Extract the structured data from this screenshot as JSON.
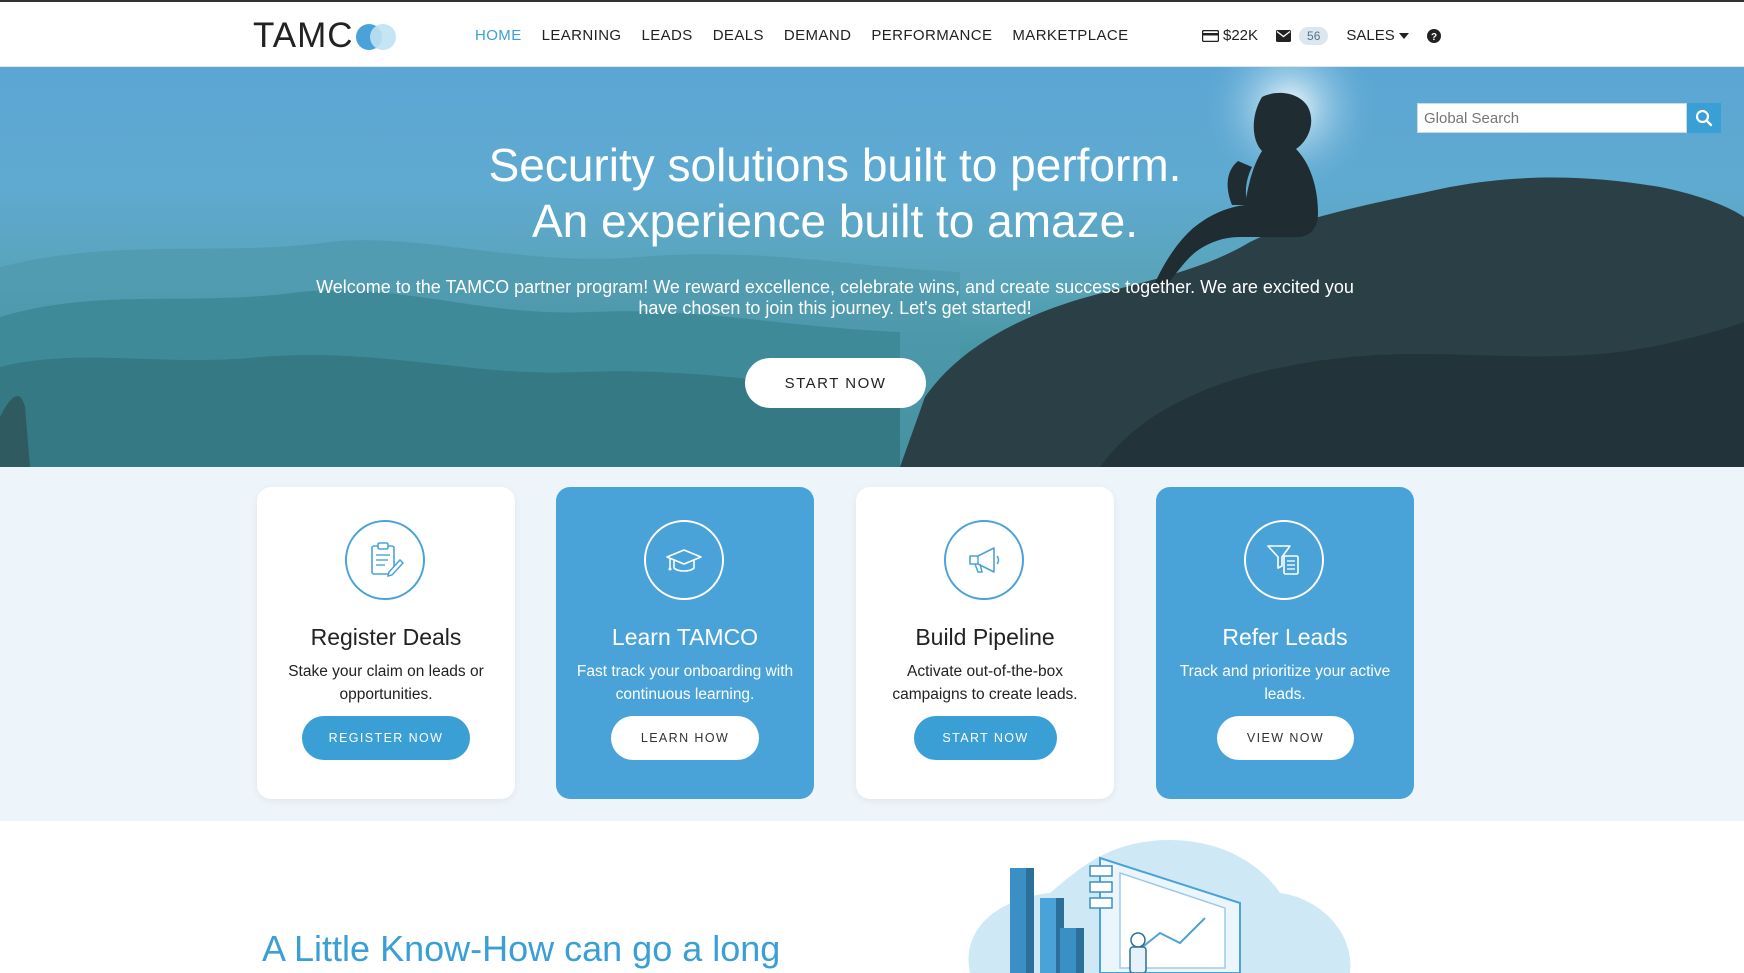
{
  "brand": {
    "logo_text": "TAMC",
    "accent": "#3a9fd5"
  },
  "nav": {
    "items": [
      "HOME",
      "LEARNING",
      "LEADS",
      "DEALS",
      "DEMAND",
      "PERFORMANCE",
      "MARKETPLACE"
    ],
    "active": "HOME"
  },
  "header_right": {
    "wallet": "$22K",
    "messages_count": "56",
    "sales_label": "SALES",
    "help_icon": "question-circle-icon"
  },
  "search": {
    "placeholder": "Global Search"
  },
  "hero": {
    "headline_line1": "Security solutions built to perform.",
    "headline_line2": "An experience built to amaze.",
    "body": "Welcome to the TAMCO partner program! We reward excellence, celebrate wins, and create success together. We are excited you have chosen to join this journey. Let's get started!",
    "cta": "START NOW"
  },
  "cards": [
    {
      "title": "Register Deals",
      "description": "Stake your claim on leads or opportunities.",
      "button": "REGISTER NOW",
      "icon": "clipboard-icon",
      "style": "white"
    },
    {
      "title": "Learn TAMCO",
      "description": "Fast track your onboarding with continuous learning.",
      "button": "LEARN HOW",
      "icon": "graduation-cap-icon",
      "style": "blue"
    },
    {
      "title": "Build Pipeline",
      "description": "Activate out-of-the-box campaigns to create leads.",
      "button": "START NOW",
      "icon": "megaphone-icon",
      "style": "white"
    },
    {
      "title": "Refer Leads",
      "description": "Track and prioritize your active leads.",
      "button": "VIEW NOW",
      "icon": "funnel-icon",
      "style": "blue"
    }
  ],
  "lower": {
    "title": "A Little Know-How can go a long"
  }
}
